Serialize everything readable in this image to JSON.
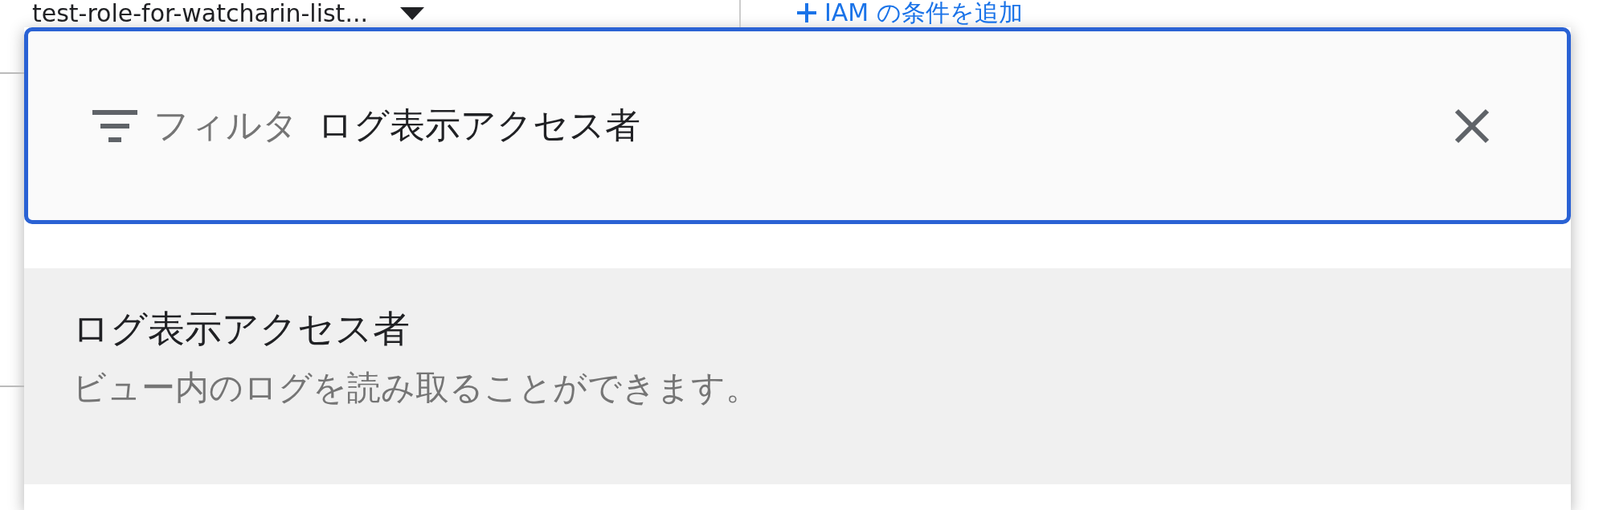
{
  "background": {
    "role_select": "test-role-for-watcharin-list...",
    "add_condition_link": "IAM の条件を追加"
  },
  "filter": {
    "label": "フィルタ",
    "value": "ログ表示アクセス者",
    "focused": true
  },
  "options": [
    {
      "title": "ログ表示アクセス者",
      "description": "ビュー内のログを読み取ることができます。",
      "selected": true
    }
  ]
}
